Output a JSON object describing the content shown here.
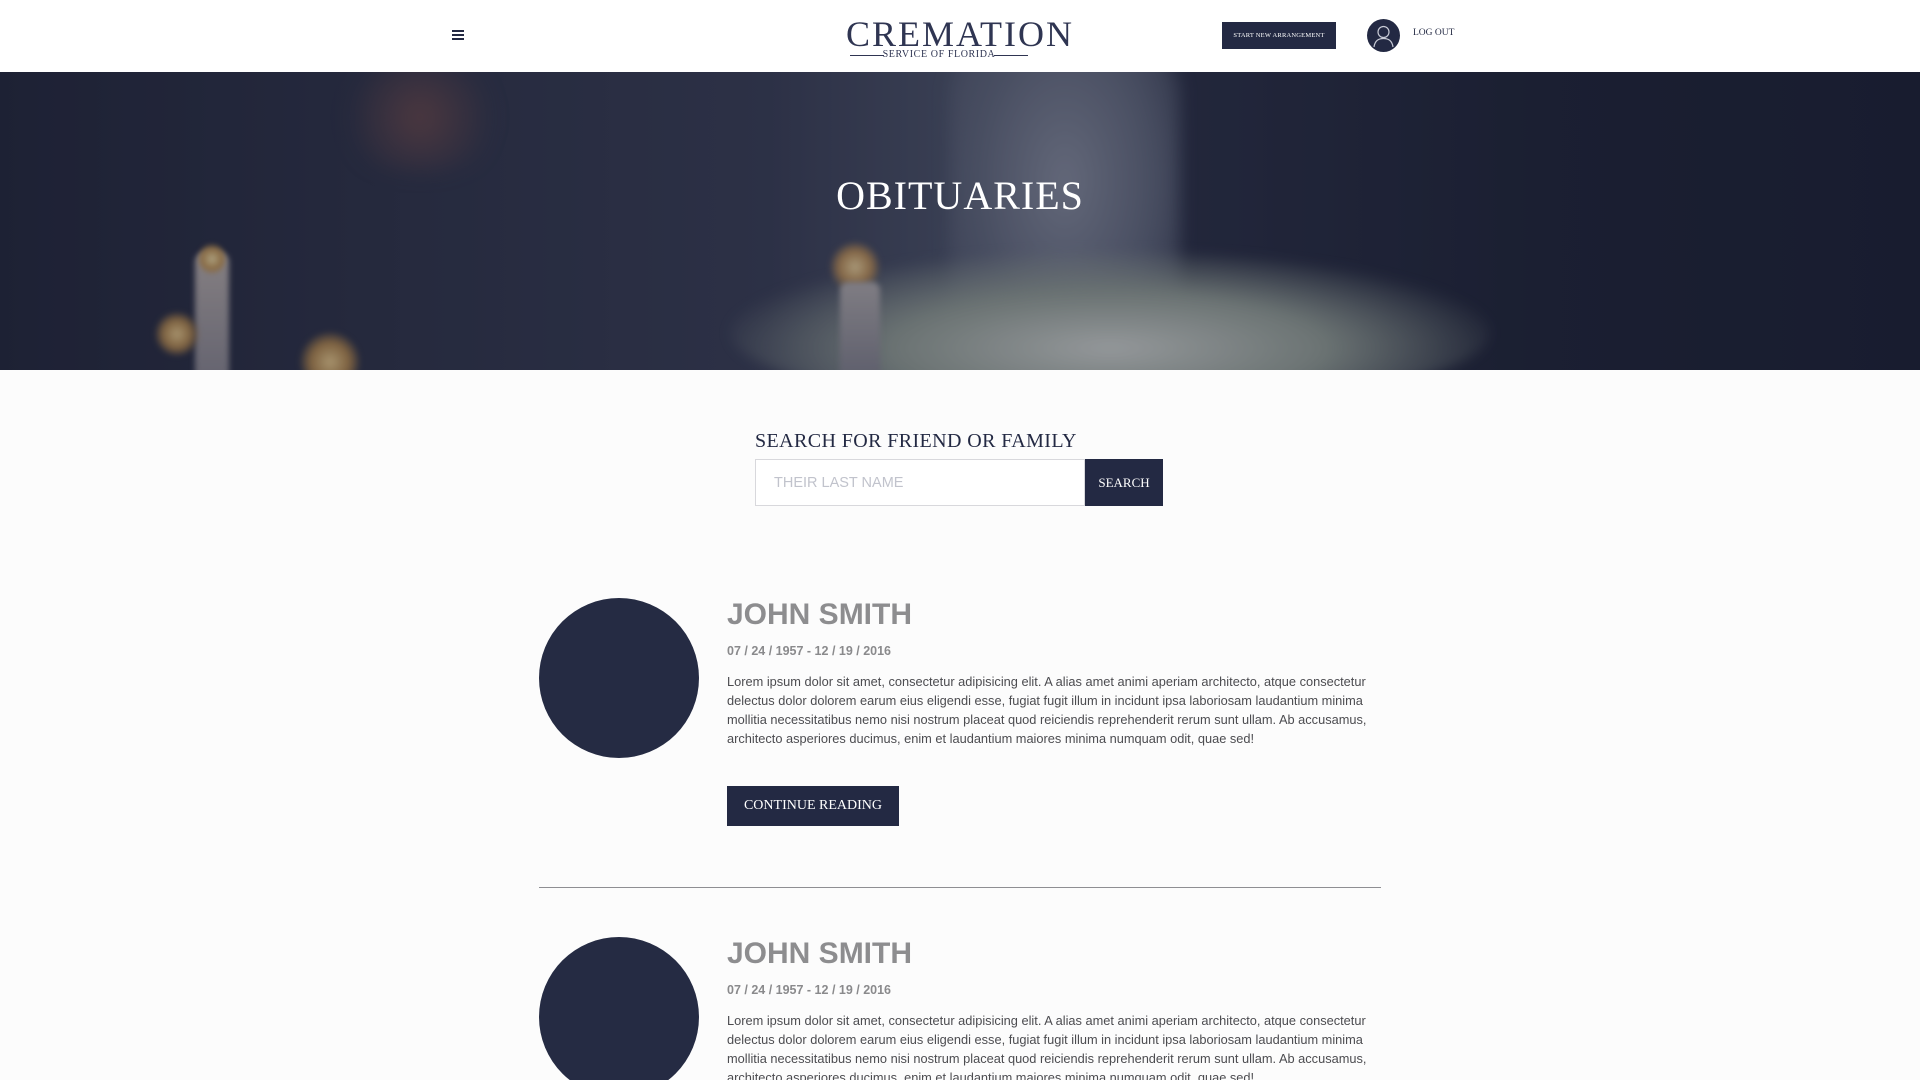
{
  "header": {
    "logo_main": "CREMATION",
    "logo_sub": "SERVICE OF FLORIDA",
    "start_button_label": "START NEW ARRANGEMENT",
    "logout_label": "LOG OUT"
  },
  "hero": {
    "title": "OBITUARIES"
  },
  "search": {
    "heading": "SEARCH FOR FRIEND OR FAMILY",
    "input_placeholder": "THEIR LAST NAME",
    "input_value": "",
    "button_label": "SEARCH"
  },
  "obituaries": [
    {
      "name": "JOHN SMITH",
      "dates": "07 / 24 / 1957 - 12 / 19 / 2016",
      "excerpt": "Lorem ipsum dolor sit amet, consectetur adipisicing elit. A alias amet animi aperiam architecto, atque consectetur delectus dolor dolorem earum eius eligendi esse, fugiat fugit illum in incidunt ipsa laboriosam laudantium minima mollitia necessitatibus nemo nisi nostrum placeat quod reiciendis reprehenderit rerum sunt ullam. Ab accusamus, architecto asperiores ducimus, enim et laudantium maiores minima numquam odit, quae sed!",
      "button_label": "CONTINUE READING"
    },
    {
      "name": "JOHN SMITH",
      "dates": "07 / 24 / 1957 - 12 / 19 / 2016",
      "excerpt": "Lorem ipsum dolor sit amet, consectetur adipisicing elit. A alias amet animi aperiam architecto, atque consectetur delectus dolor dolorem earum eius eligendi esse, fugiat fugit illum in incidunt ipsa laboriosam laudantium minima mollitia necessitatibus nemo nisi nostrum placeat quod reiciendis reprehenderit rerum sunt ullam. Ab accusamus, architecto asperiores ducimus, enim et laudantium maiores minima numquam odit, quae sed!"
    }
  ],
  "colors": {
    "brand_navy": "#232943",
    "photo_placeholder": "#252b43",
    "name_gray": "#8d8d8f",
    "body_text": "#4c4c50"
  },
  "icons": {
    "menu": "hamburger-menu-icon",
    "account": "user-avatar-icon"
  }
}
